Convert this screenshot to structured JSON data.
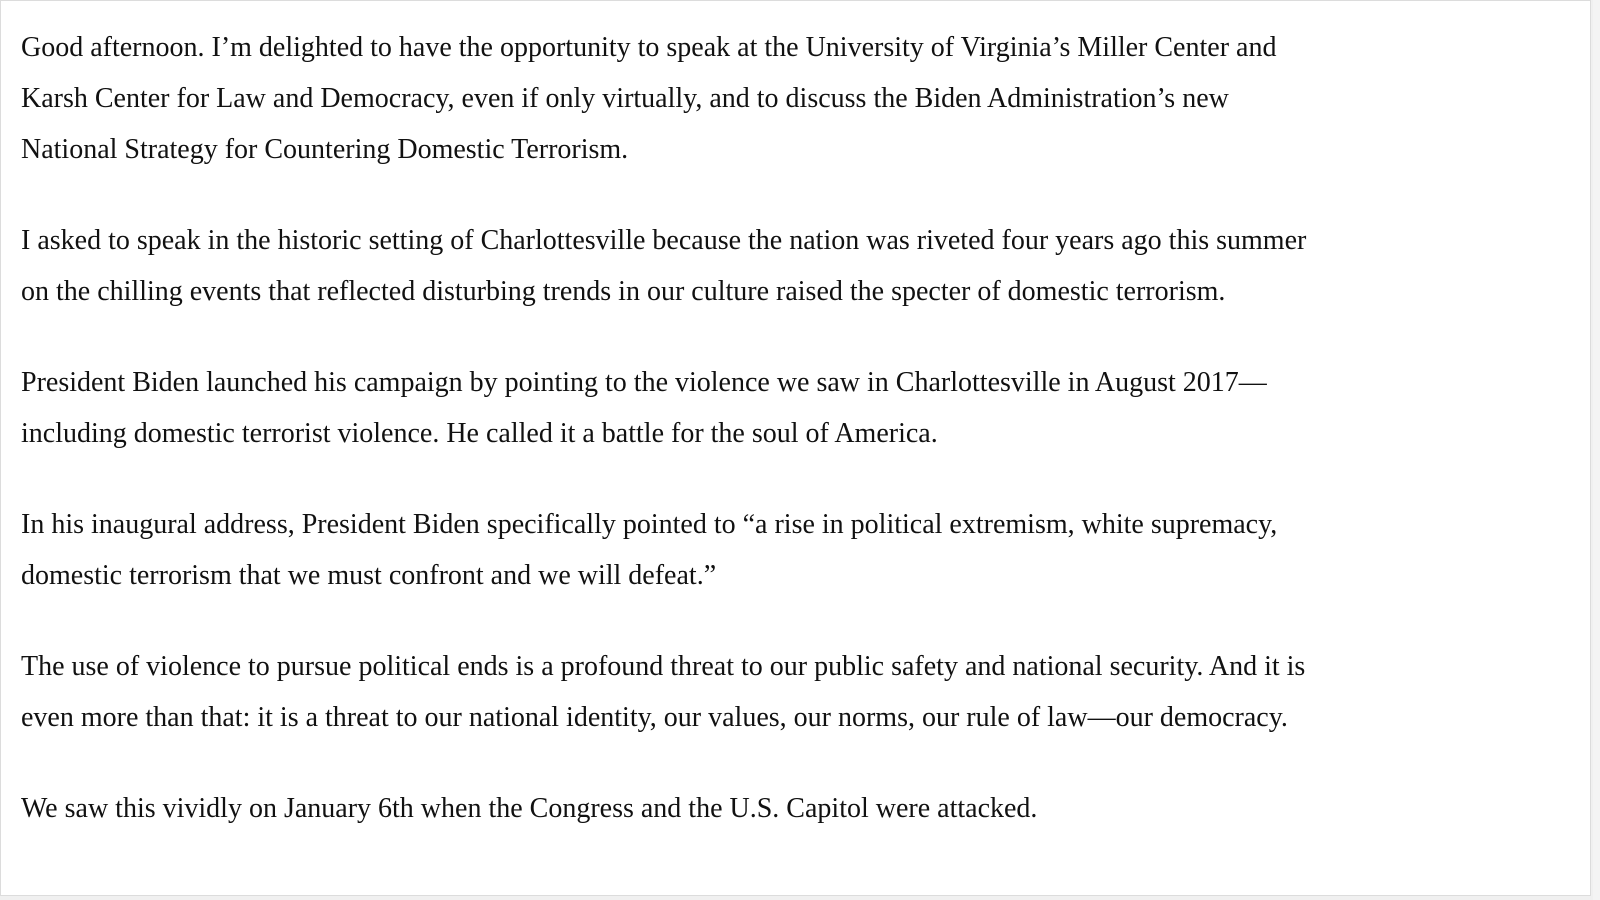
{
  "document": {
    "paragraphs": [
      [
        "Good afternoon. I’m delighted to have the opportunity to speak at the University of Virginia’s Miller Center and",
        "Karsh Center for Law and Democracy, even if only virtually, and to discuss the Biden Administration’s new",
        "National Strategy for Countering Domestic Terrorism."
      ],
      [
        "I asked to speak in the historic setting of Charlottesville because the nation was riveted four years ago this summer",
        "on the chilling events that reflected disturbing trends in our culture raised the specter of domestic terrorism."
      ],
      [
        "President Biden launched his campaign by pointing to the violence we saw in Charlottesville in August 2017—",
        "including domestic terrorist violence. He called it a battle for the soul of America."
      ],
      [
        "In his inaugural address, President Biden specifically pointed to “a rise in political extremism, white supremacy,",
        "domestic terrorism that we must confront and we will defeat.”"
      ],
      [
        "The use of violence to pursue political ends is a profound threat to our public safety and national security. And it is",
        "even more than that: it is a threat to our national identity, our values, our norms, our rule of law—our democracy."
      ],
      [
        "We saw this vividly on January 6th when the Congress and the U.S. Capitol were attacked."
      ]
    ]
  }
}
